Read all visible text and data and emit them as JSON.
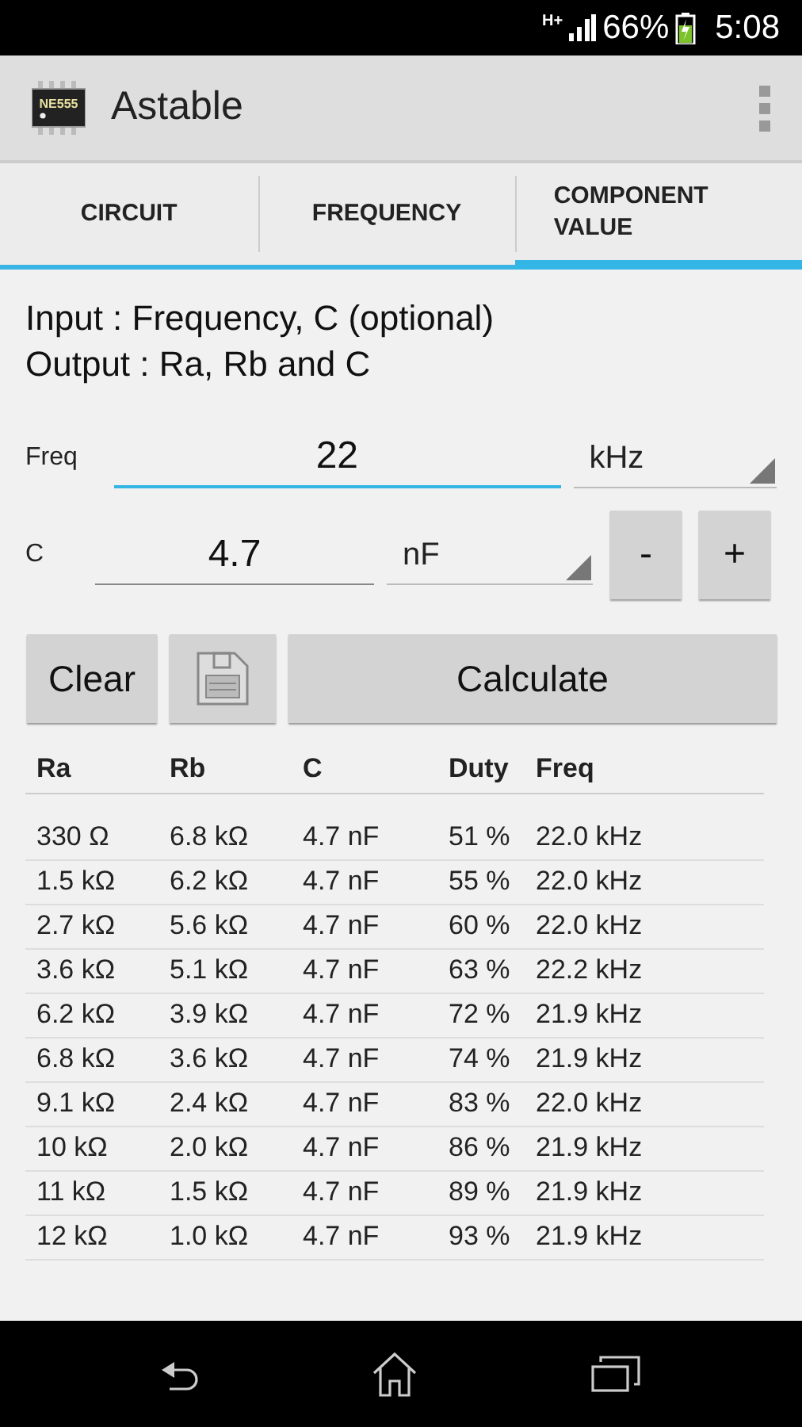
{
  "status_bar": {
    "network": "H+",
    "battery": "66%",
    "time": "5:08"
  },
  "app_bar": {
    "logo_text": "NE555",
    "title": "Astable"
  },
  "tabs": [
    {
      "label": "CIRCUIT",
      "selected": false
    },
    {
      "label": "FREQUENCY",
      "selected": false
    },
    {
      "label": "COMPONENT VALUE",
      "selected": true
    }
  ],
  "info": [
    "Input : Frequency, C (optional)",
    "Output : Ra, Rb and C"
  ],
  "freq": {
    "label": "Freq",
    "value": "22",
    "focused": true,
    "unit": "kHz"
  },
  "cap": {
    "label": "C",
    "value": "4.7",
    "focused": false,
    "unit": "nF",
    "minus": "-",
    "plus": "+"
  },
  "buttons": {
    "clear": "Clear",
    "calculate": "Calculate"
  },
  "table": {
    "columns": [
      "Ra",
      "Rb",
      "C",
      "Duty",
      "Freq"
    ],
    "rows": [
      [
        "330 Ω",
        "6.8 kΩ",
        "4.7 nF",
        "51 %",
        "22.0 kHz"
      ],
      [
        "1.5 kΩ",
        "6.2 kΩ",
        "4.7 nF",
        "55 %",
        "22.0 kHz"
      ],
      [
        "2.7 kΩ",
        "5.6 kΩ",
        "4.7 nF",
        "60 %",
        "22.0 kHz"
      ],
      [
        "3.6 kΩ",
        "5.1 kΩ",
        "4.7 nF",
        "63 %",
        "22.2 kHz"
      ],
      [
        "6.2 kΩ",
        "3.9 kΩ",
        "4.7 nF",
        "72 %",
        "21.9 kHz"
      ],
      [
        "6.8 kΩ",
        "3.6 kΩ",
        "4.7 nF",
        "74 %",
        "21.9 kHz"
      ],
      [
        "9.1 kΩ",
        "2.4 kΩ",
        "4.7 nF",
        "83 %",
        "22.0 kHz"
      ],
      [
        "10 kΩ",
        "2.0 kΩ",
        "4.7 nF",
        "86 %",
        "21.9 kHz"
      ],
      [
        "11 kΩ",
        "1.5 kΩ",
        "4.7 nF",
        "89 %",
        "21.9 kHz"
      ],
      [
        "12 kΩ",
        "1.0 kΩ",
        "4.7 nF",
        "93 %",
        "21.9 kHz"
      ]
    ]
  }
}
